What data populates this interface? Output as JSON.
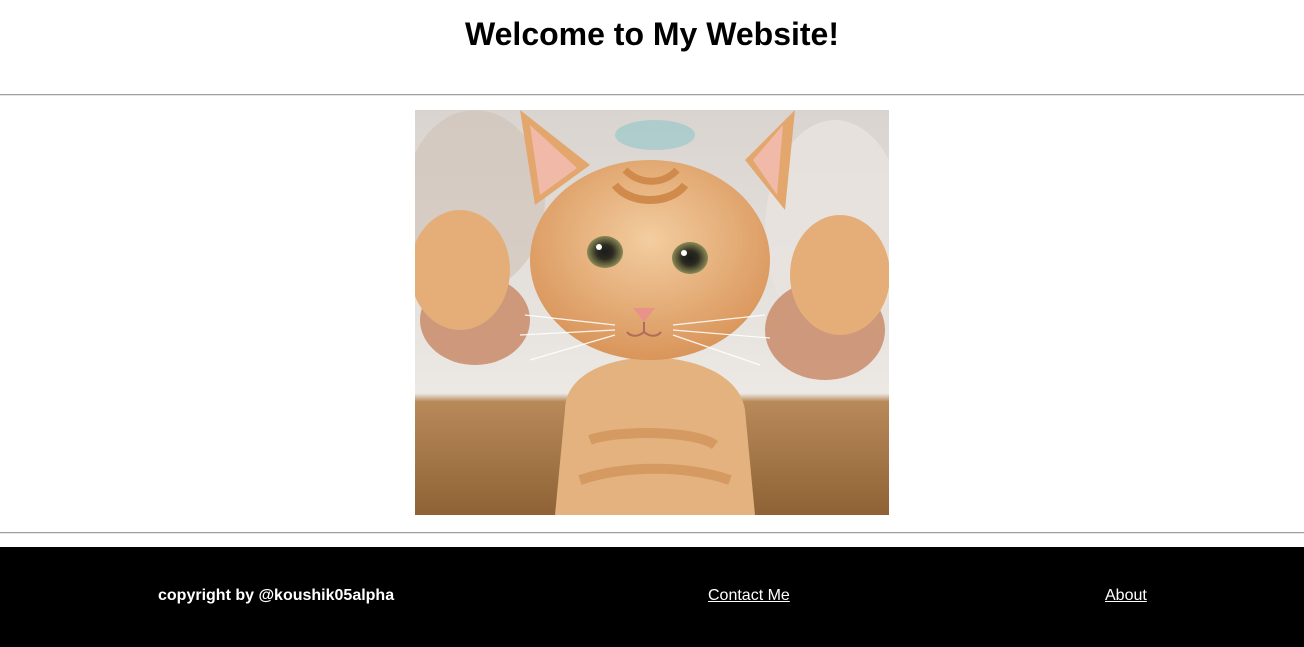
{
  "header": {
    "title": "Welcome to My Website!"
  },
  "main": {
    "image_subject": "orange-tabby-kitten-photo"
  },
  "footer": {
    "copyright": "copyright by @koushik05alpha",
    "contact_label": "Contact Me",
    "about_label": "About"
  },
  "colors": {
    "footer_bg": "#000000",
    "footer_text": "#ffffff",
    "rule": "#a0a0a0"
  }
}
